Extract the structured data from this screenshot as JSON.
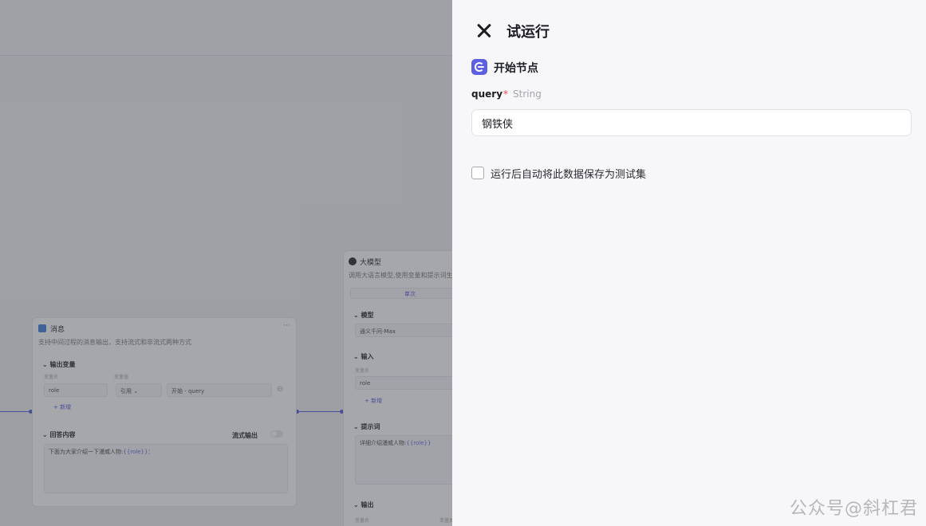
{
  "drawer": {
    "title": "试运行",
    "node_name": "开始节点",
    "field": {
      "name": "query",
      "required_mark": "*",
      "type": "String",
      "value": "钢铁侠"
    },
    "checkbox": {
      "label": "运行后自动将此数据保存为测试集",
      "checked": false
    }
  },
  "canvas": {
    "message_node": {
      "title": "消息",
      "menu": "···",
      "description": "支持中间过程的消息输出，支持流式和非流式两种方式",
      "output_section": "输出变量",
      "col_name": "变量名",
      "col_value": "变量值",
      "var_name": "role",
      "ref_type": "引用",
      "ref_value": "开始 - query",
      "add_label": "+ 新增",
      "answer_section": "回答内容",
      "stream_label": "流式输出",
      "answer_prefix": "下面为大家介绍一下漫威人物:",
      "answer_var": "{{role}}",
      "answer_suffix": "："
    },
    "llm_node": {
      "title": "大模型",
      "description": "调用大语言模型,使用变量和提示词生成",
      "mode_tab": "单次",
      "model_section": "模型",
      "model_value": "通义千问-Max",
      "input_section": "输入",
      "col_name": "变量名",
      "var_name": "role",
      "add_label": "+ 新增",
      "prompt_section": "提示词",
      "prompt_prefix": "详细介绍漫威人物:",
      "prompt_var": "{{role}}",
      "output_section": "输出",
      "out_col_name": "变量名",
      "out_col_type": "变量类型"
    }
  },
  "watermark": "公众号@斜杠君",
  "colors": {
    "accent": "#5b5fe0",
    "required": "#e5484d",
    "drawer_bg": "#f7f7fa"
  }
}
